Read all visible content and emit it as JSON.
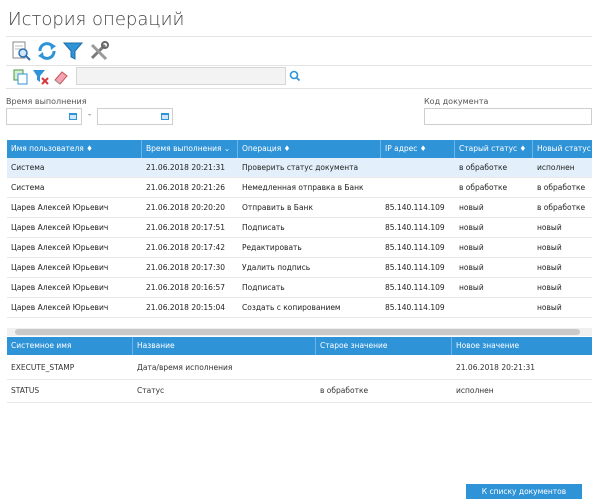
{
  "page": {
    "title": "История операций"
  },
  "toolbar": {
    "view_icon": "view-document-icon",
    "refresh_icon": "refresh-icon",
    "filter_icon": "filter-icon",
    "settings_icon": "tools-icon",
    "copy_icon": "copy-icon",
    "filter_clear_icon": "filter-clear-icon",
    "clear_icon": "eraser-icon",
    "search": {
      "value": "",
      "placeholder": ""
    },
    "search_icon": "search-icon"
  },
  "filters": {
    "exec_time_label": "Время выполнения",
    "date_from": "",
    "date_to": "",
    "range_dash": "-",
    "doc_code_label": "Код документа",
    "doc_code": ""
  },
  "operations": {
    "columns": [
      "Имя пользователя ♦",
      "Время выполнения ⌄",
      "Операция ♦",
      "IP адрес ♦",
      "Старый статус ♦",
      "Новый статус"
    ],
    "rows": [
      [
        "Система",
        "21.06.2018 20:21:31",
        "Проверить статус документа",
        "",
        "в обработке",
        "исполнен"
      ],
      [
        "Система",
        "21.06.2018 20:21:26",
        "Немедленная отправка в Банк",
        "",
        "в обработке",
        "в обработке"
      ],
      [
        "Царев Алексей Юрьевич",
        "21.06.2018 20:20:20",
        "Отправить в Банк",
        "85.140.114.109",
        "новый",
        "в обработке"
      ],
      [
        "Царев Алексей Юрьевич",
        "21.06.2018 20:17:51",
        "Подписать",
        "85.140.114.109",
        "новый",
        "новый"
      ],
      [
        "Царев Алексей Юрьевич",
        "21.06.2018 20:17:42",
        "Редактировать",
        "85.140.114.109",
        "новый",
        "новый"
      ],
      [
        "Царев Алексей Юрьевич",
        "21.06.2018 20:17:30",
        "Удалить подпись",
        "85.140.114.109",
        "новый",
        "новый"
      ],
      [
        "Царев Алексей Юрьевич",
        "21.06.2018 20:16:57",
        "Подписать",
        "85.140.114.109",
        "новый",
        "новый"
      ],
      [
        "Царев Алексей Юрьевич",
        "21.06.2018 20:15:04",
        "Создать с копированием",
        "85.140.114.109",
        "",
        "новый"
      ]
    ],
    "selected_row": 0
  },
  "details": {
    "columns": [
      "Системное имя",
      "Название",
      "Старое значение",
      "Новое значение"
    ],
    "rows": [
      [
        "EXECUTE_STAMP",
        "Дата/время исполнения",
        "",
        "21.06.2018 20:21:31"
      ],
      [
        "STATUS",
        "Статус",
        "в обработке",
        "исполнен"
      ]
    ]
  },
  "actions": {
    "back_label": "К списку документов"
  },
  "colors": {
    "accent": "#2f93d8",
    "selected_row": "#e3f0fb"
  }
}
